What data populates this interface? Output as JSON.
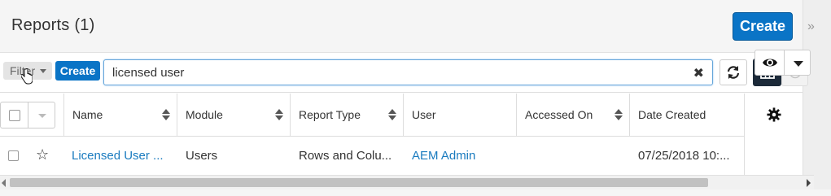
{
  "header": {
    "title": "Reports",
    "count": "(1)",
    "create_label": "Create",
    "collapse_icon": "double-chevron-right-icon"
  },
  "toolbar": {
    "filter_label": "Filter",
    "create_label": "Create",
    "search_value": "licensed user",
    "clear_icon": "close-icon",
    "refresh_icon": "refresh-icon",
    "grid_view_icon": "grid-icon",
    "history_icon": "clock-icon"
  },
  "table": {
    "columns": [
      "Name",
      "Module",
      "Report Type",
      "User",
      "Accessed On",
      "Date Created"
    ],
    "settings_icon": "gear-icon",
    "rows": [
      {
        "name": "Licensed User ...",
        "module": "Users",
        "report_type": "Rows and Colu...",
        "user": "AEM Admin",
        "accessed_on": "",
        "date_created": "07/25/2018 10:..."
      }
    ]
  },
  "colors": {
    "primary": "#0a74c6",
    "link": "#1a7bbf",
    "grid_active": "#1c2a39"
  }
}
